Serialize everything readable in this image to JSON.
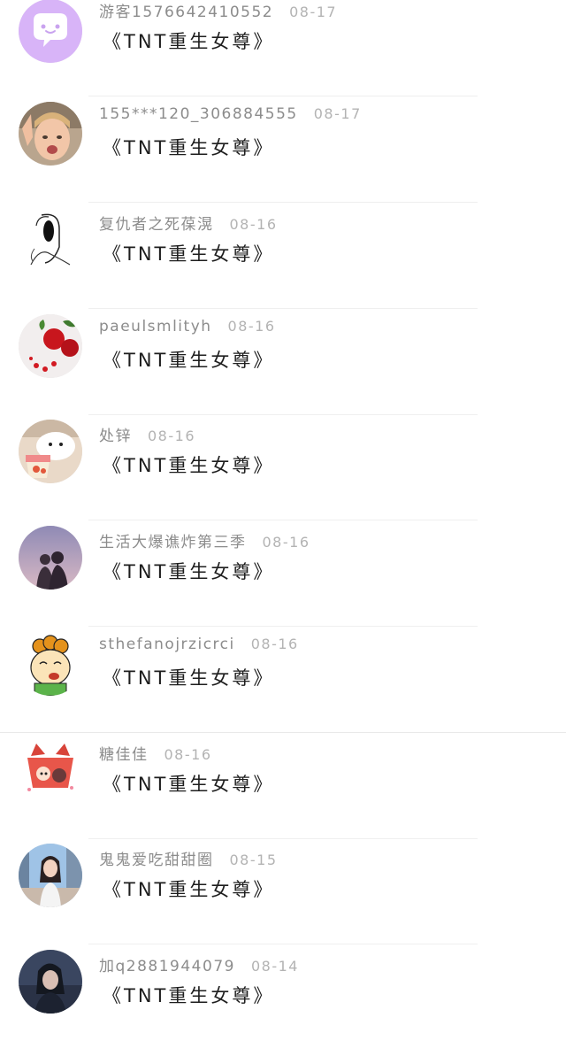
{
  "comments": [
    {
      "user": "游客1576642410552",
      "date": "08-17",
      "text": "《TNT重生女尊》",
      "avatar": "purple-chat-bubble-avatar"
    },
    {
      "user": "155***120_306884555",
      "date": "08-17",
      "text": "《TNT重生女尊》",
      "avatar": "child-photo-avatar"
    },
    {
      "user": "复仇者之死葆滉",
      "date": "08-16",
      "text": "《TNT重生女尊》",
      "avatar": "sketch-girl-avatar"
    },
    {
      "user": "paeulsmlityh",
      "date": "08-16",
      "text": "《TNT重生女尊》",
      "avatar": "roses-avatar"
    },
    {
      "user": "处锌",
      "date": "08-16",
      "text": "《TNT重生女尊》",
      "avatar": "bear-cup-avatar"
    },
    {
      "user": "生活大爆谯炸第三季",
      "date": "08-16",
      "text": "《TNT重生女尊》",
      "avatar": "couple-sunset-avatar"
    },
    {
      "user": "sthefanojrzicrci",
      "date": "08-16",
      "text": "《TNT重生女尊》",
      "avatar": "cartoon-boy-avatar"
    },
    {
      "user": "糖佳佳",
      "date": "08-16",
      "text": "《TNT重生女尊》",
      "avatar": "anime-girl-avatar"
    },
    {
      "user": "鬼鬼爱吃甜甜圈",
      "date": "08-15",
      "text": "《TNT重生女尊》",
      "avatar": "city-girl-avatar"
    },
    {
      "user": "加q2881944079",
      "date": "08-14",
      "text": "《TNT重生女尊》",
      "avatar": "dark-portrait-avatar"
    }
  ]
}
